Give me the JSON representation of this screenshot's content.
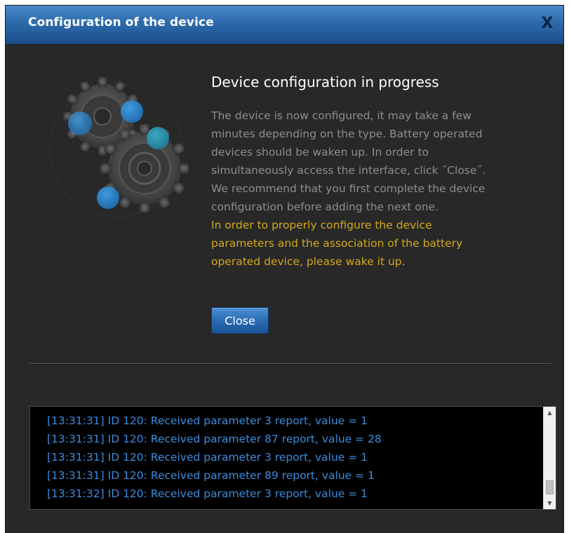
{
  "dialog": {
    "title": "Configuration of the device",
    "close_icon_label": "X"
  },
  "content": {
    "heading": "Device configuration in progress",
    "description_lines": [
      "The device is now configured, it may take a few",
      "minutes depending on the type. Battery operated",
      "devices should be waken up. In order to",
      "simultaneously access the interface, click ˝Close˝.",
      "We recommend that you first complete the device",
      "configuration before adding the next one."
    ],
    "warning_lines": [
      "In order to properly configure the device",
      "parameters and the association of the battery",
      "operated device, please wake it up."
    ],
    "close_button_label": "Close"
  },
  "log": {
    "lines": [
      "[13:31:31] ID 120: Received parameter 3 report, value = 1",
      "[13:31:31] ID 120: Received parameter 87 report, value = 28",
      "[13:31:31] ID 120: Received parameter 3 report, value = 1",
      "[13:31:31] ID 120: Received parameter 89 report, value = 1",
      "[13:31:32] ID 120: Received parameter 3 report, value = 1"
    ]
  },
  "icons": {
    "titlebar_close": "close-icon",
    "illustration": "gears-icon",
    "scroll_up": "scroll-up-arrow-icon",
    "scroll_down": "scroll-down-arrow-icon"
  },
  "colors": {
    "titlebar": "#2d6aab",
    "dialog_background": "#282828",
    "heading_text": "#ffffff",
    "description_text": "#8e8e8e",
    "warning_text": "#d2a81e",
    "log_text": "#3a8cdc",
    "button": "#2a6db4",
    "gear_circles": "#2a8ee0"
  }
}
